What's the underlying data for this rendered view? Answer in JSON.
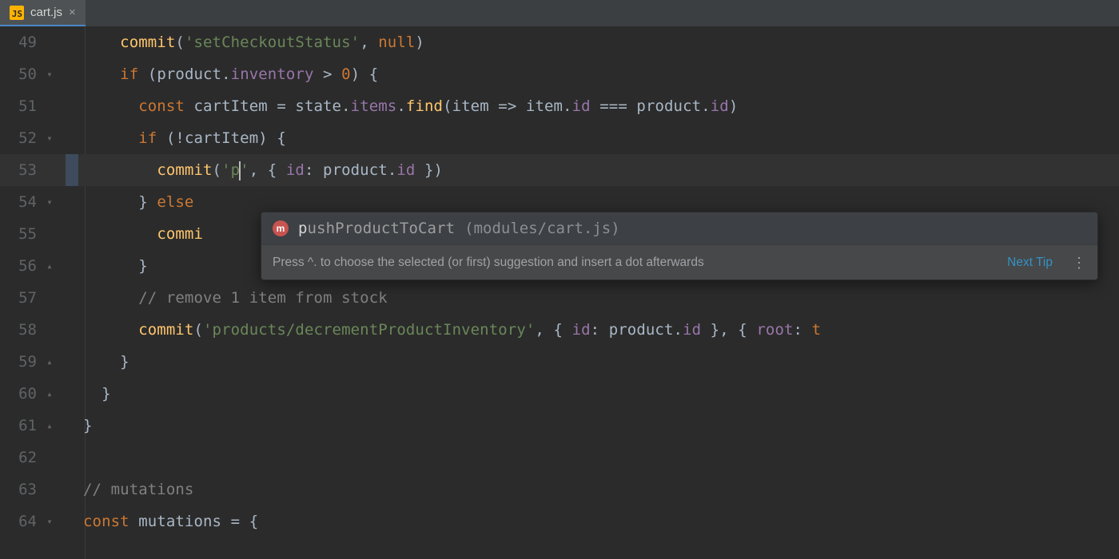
{
  "tab": {
    "label": "cart.js"
  },
  "icons": {
    "js": "JS",
    "close": "×",
    "fold_down": "▾",
    "fold_up": "▴",
    "mutation": "m",
    "kebab": "⋮"
  },
  "lines": [
    {
      "n": 49,
      "fold": "",
      "indent": 4,
      "tokens": [
        {
          "c": "fn",
          "t": "commit"
        },
        {
          "c": "punct",
          "t": "("
        },
        {
          "c": "str",
          "t": "'setCheckoutStatus'"
        },
        {
          "c": "punct",
          "t": ", "
        },
        {
          "c": "builtin",
          "t": "null"
        },
        {
          "c": "punct",
          "t": ")"
        }
      ]
    },
    {
      "n": 50,
      "fold": "down",
      "indent": 4,
      "tokens": [
        {
          "c": "kw",
          "t": "if "
        },
        {
          "c": "punct",
          "t": "("
        },
        {
          "c": "ident",
          "t": "product"
        },
        {
          "c": "punct",
          "t": "."
        },
        {
          "c": "prop",
          "t": "inventory"
        },
        {
          "c": "punct",
          "t": " > "
        },
        {
          "c": "builtin",
          "t": "0"
        },
        {
          "c": "punct",
          "t": ") {"
        }
      ]
    },
    {
      "n": 51,
      "fold": "",
      "indent": 6,
      "tokens": [
        {
          "c": "kw",
          "t": "const "
        },
        {
          "c": "ident",
          "t": "cartItem"
        },
        {
          "c": "punct",
          "t": " = "
        },
        {
          "c": "ident",
          "t": "state"
        },
        {
          "c": "punct",
          "t": "."
        },
        {
          "c": "prop",
          "t": "items"
        },
        {
          "c": "punct",
          "t": "."
        },
        {
          "c": "fn",
          "t": "find"
        },
        {
          "c": "punct",
          "t": "("
        },
        {
          "c": "ident",
          "t": "item"
        },
        {
          "c": "punct",
          "t": " => "
        },
        {
          "c": "ident",
          "t": "item"
        },
        {
          "c": "punct",
          "t": "."
        },
        {
          "c": "prop",
          "t": "id"
        },
        {
          "c": "punct",
          "t": " === "
        },
        {
          "c": "ident",
          "t": "product"
        },
        {
          "c": "punct",
          "t": "."
        },
        {
          "c": "prop",
          "t": "id"
        },
        {
          "c": "punct",
          "t": ")"
        }
      ]
    },
    {
      "n": 52,
      "fold": "down",
      "indent": 6,
      "tokens": [
        {
          "c": "kw",
          "t": "if "
        },
        {
          "c": "punct",
          "t": "(!"
        },
        {
          "c": "ident",
          "t": "cartItem"
        },
        {
          "c": "punct",
          "t": ") {"
        }
      ]
    },
    {
      "n": 53,
      "fold": "",
      "indent": 8,
      "cursor": true,
      "tokens": [
        {
          "c": "fn",
          "t": "commit"
        },
        {
          "c": "punct",
          "t": "("
        },
        {
          "c": "str",
          "t": "'p"
        },
        {
          "c": "caret",
          "t": ""
        },
        {
          "c": "str",
          "t": "'"
        },
        {
          "c": "punct",
          "t": ", { "
        },
        {
          "c": "prop",
          "t": "id"
        },
        {
          "c": "punct",
          "t": ": "
        },
        {
          "c": "ident",
          "t": "product"
        },
        {
          "c": "punct",
          "t": "."
        },
        {
          "c": "prop",
          "t": "id"
        },
        {
          "c": "punct",
          "t": " })"
        }
      ]
    },
    {
      "n": 54,
      "fold": "down",
      "indent": 6,
      "tokens": [
        {
          "c": "punct",
          "t": "} "
        },
        {
          "c": "kw",
          "t": "else "
        },
        {
          "c": "punct",
          "t": ""
        }
      ]
    },
    {
      "n": 55,
      "fold": "",
      "indent": 8,
      "tokens": [
        {
          "c": "fn",
          "t": "commi"
        }
      ]
    },
    {
      "n": 56,
      "fold": "up",
      "indent": 6,
      "tokens": [
        {
          "c": "punct",
          "t": "}"
        }
      ]
    },
    {
      "n": 57,
      "fold": "",
      "indent": 6,
      "tokens": [
        {
          "c": "comment",
          "t": "// remove 1 item from stock"
        }
      ]
    },
    {
      "n": 58,
      "fold": "",
      "indent": 6,
      "tokens": [
        {
          "c": "fn",
          "t": "commit"
        },
        {
          "c": "punct",
          "t": "("
        },
        {
          "c": "str",
          "t": "'products/decrementProductInventory'"
        },
        {
          "c": "punct",
          "t": ", { "
        },
        {
          "c": "prop",
          "t": "id"
        },
        {
          "c": "punct",
          "t": ": "
        },
        {
          "c": "ident",
          "t": "product"
        },
        {
          "c": "punct",
          "t": "."
        },
        {
          "c": "prop",
          "t": "id"
        },
        {
          "c": "punct",
          "t": " }, { "
        },
        {
          "c": "prop",
          "t": "root"
        },
        {
          "c": "punct",
          "t": ": "
        },
        {
          "c": "builtin",
          "t": "t"
        }
      ]
    },
    {
      "n": 59,
      "fold": "up",
      "indent": 4,
      "tokens": [
        {
          "c": "punct",
          "t": "}"
        }
      ]
    },
    {
      "n": 60,
      "fold": "up",
      "indent": 2,
      "tokens": [
        {
          "c": "punct",
          "t": "}"
        }
      ]
    },
    {
      "n": 61,
      "fold": "up",
      "indent": 0,
      "tokens": [
        {
          "c": "punct",
          "t": "}"
        }
      ]
    },
    {
      "n": 62,
      "fold": "",
      "indent": 0,
      "tokens": []
    },
    {
      "n": 63,
      "fold": "",
      "indent": 0,
      "tokens": [
        {
          "c": "comment",
          "t": "// mutations"
        }
      ]
    },
    {
      "n": 64,
      "fold": "down",
      "indent": 0,
      "tokens": [
        {
          "c": "kw",
          "t": "const "
        },
        {
          "c": "ident",
          "t": "mutations"
        },
        {
          "c": "punct",
          "t": " = {"
        }
      ]
    }
  ],
  "popup": {
    "suggestion_match": "p",
    "suggestion_rest": "ushProductToCart",
    "suggestion_loc": "(modules/cart.js)",
    "tip_msg": "Press ^. to choose the selected (or first) suggestion and insert a dot afterwards",
    "tip_next": "Next Tip"
  }
}
